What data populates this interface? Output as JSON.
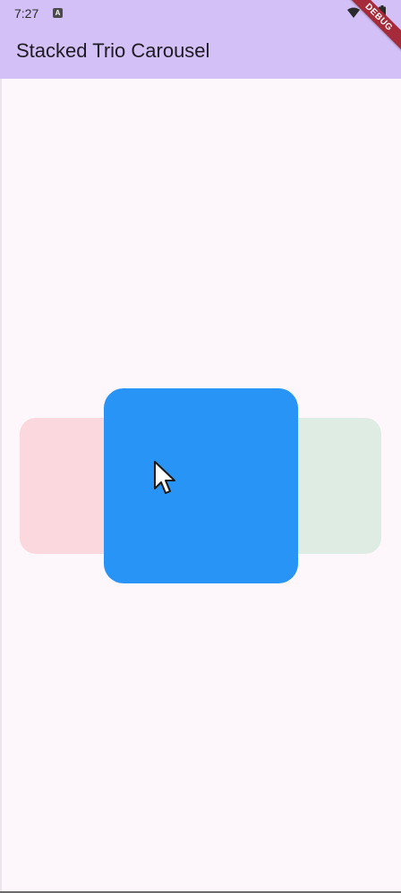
{
  "status_bar": {
    "time": "7:27",
    "app_indicator": "A",
    "icons": [
      "app-notification-icon",
      "wifi-icon",
      "battery-icon"
    ]
  },
  "debug_banner": {
    "label": "DEBUG"
  },
  "app_bar": {
    "title": "Stacked Trio Carousel",
    "background": "#d3c0f6"
  },
  "carousel": {
    "cards": [
      {
        "position": "left",
        "color": "#fbd8dd"
      },
      {
        "position": "center",
        "color": "#2894f5"
      },
      {
        "position": "right",
        "color": "#dfece3"
      }
    ]
  },
  "cursor": {
    "icon": "pointer-cursor-icon"
  }
}
